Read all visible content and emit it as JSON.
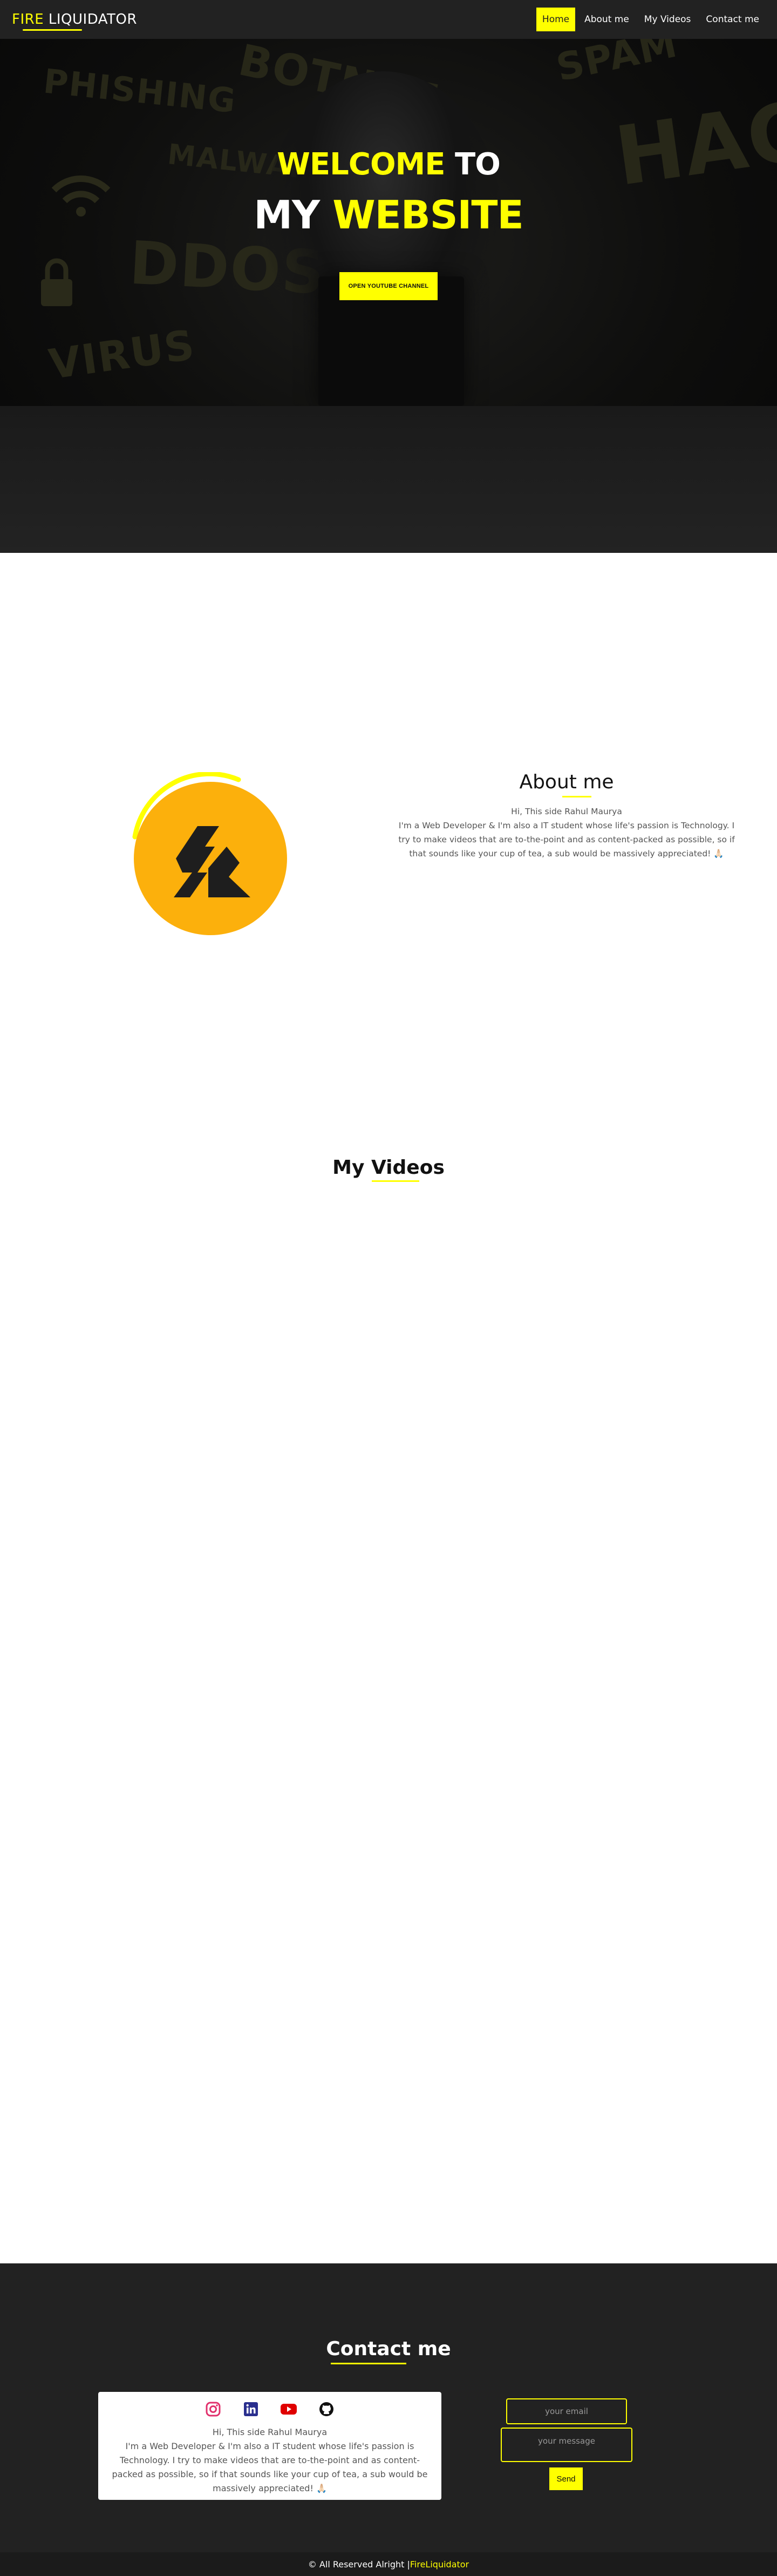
{
  "nav": {
    "logo_accent": "FIRE",
    "logo_rest": " LIQUIDATOR",
    "links": [
      "Home",
      "About me",
      "My Videos",
      "Contact me"
    ],
    "active_index": 0
  },
  "hero": {
    "line1_highlight": "WELCOME",
    "line1_rest": " TO",
    "line2_rest": "MY ",
    "line2_highlight": "WEBSITE",
    "button_label": "OPEN YOUTUBE CHANNEL",
    "background_words": [
      "PHISHING",
      "BOTNET",
      "SPAM",
      "MALWARE",
      "DDOS",
      "VIRUS",
      "HACK"
    ]
  },
  "about": {
    "title": "About me",
    "greeting": "Hi, This side Rahul Maurya",
    "bio": "I'm a Web Developer & I'm also a IT student whose life's passion is Technology. I try to make videos that are to-the-point and as content-packed as possible, so if that sounds like your cup of tea, a sub would be massively appreciated! 🙏🏻"
  },
  "videos": {
    "title_part1": "My ",
    "title_part2": "Videos"
  },
  "contact": {
    "title": "Contact me",
    "greeting": "Hi, This side Rahul Maurya",
    "bio": "I'm a Web Developer & I'm also a IT student whose life's passion is Technology. I try to make videos that are to-the-point and as content-packed as possible, so if that sounds like your cup of tea, a sub would be massively appreciated! 🙏🏻",
    "email_placeholder": "your email",
    "message_placeholder": "your message",
    "send_label": "Send",
    "socials": [
      "instagram-icon",
      "linkedin-icon",
      "youtube-icon",
      "github-icon"
    ]
  },
  "footer": {
    "text": "© All Reserved Alright | ",
    "brand": "FireLiquidator"
  },
  "colors": {
    "accent": "#ffff00",
    "dark": "#222222",
    "avatar_bg": "#fcb00c"
  }
}
